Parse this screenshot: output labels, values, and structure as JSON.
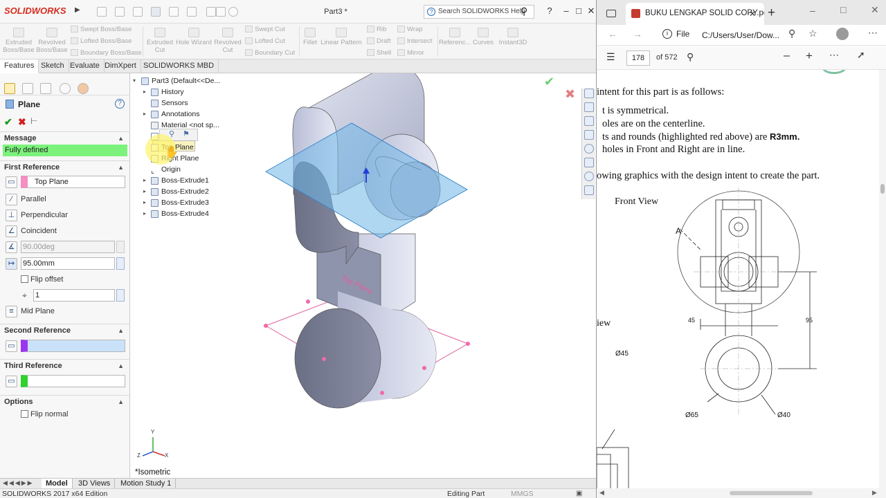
{
  "solidworks": {
    "logo": "SOLIDWORKS",
    "doc_title": "Part3 *",
    "search_placeholder": "Search SOLIDWORKS Help",
    "help_label": "?",
    "commands": {
      "extruded_boss": "Extruded Boss/Base",
      "revolved_boss": "Revolved Boss/Base",
      "swept_boss": "Swept Boss/Base",
      "lofted_boss": "Lofted Boss/Base",
      "boundary_boss": "Boundary Boss/Base",
      "extruded_cut": "Extruded Cut",
      "hole_wizard": "Hole Wizard",
      "revolved_cut": "Revolved Cut",
      "swept_cut": "Swept Cut",
      "lofted_cut": "Lofted Cut",
      "boundary_cut": "Boundary Cut",
      "fillet": "Fillet",
      "linear_pattern": "Linear Pattern",
      "rib": "Rib",
      "draft": "Draft",
      "shell": "Shell",
      "wrap": "Wrap",
      "intersect": "Intersect",
      "mirror": "Mirror",
      "reference": "Referenc...",
      "curves": "Curves",
      "instant3d": "Instant3D"
    },
    "tabs": [
      "Features",
      "Sketch",
      "Evaluate",
      "DimXpert",
      "SOLIDWORKS MBD"
    ],
    "property_manager": {
      "title": "Plane",
      "message_head": "Message",
      "message_text": "Fully defined",
      "first_ref_head": "First Reference",
      "first_ref_value": "Top Plane",
      "parallel": "Parallel",
      "perpendicular": "Perpendicular",
      "coincident": "Coincident",
      "angle_value": "90.00deg",
      "distance_value": "95.00mm",
      "flip_offset": "Flip offset",
      "instances_value": "1",
      "mid_plane": "Mid Plane",
      "second_ref_head": "Second Reference",
      "third_ref_head": "Third Reference",
      "options_head": "Options",
      "flip_normal": "Flip normal"
    },
    "tree": {
      "root": "Part3  (Default<<De...",
      "items": [
        "History",
        "Sensors",
        "Annotations",
        "Material <not sp...",
        "Fr",
        "Top Plane",
        "Right Plane",
        "Origin",
        "Boss-Extrude1",
        "Boss-Extrude2",
        "Boss-Extrude3",
        "Boss-Extrude4"
      ]
    },
    "view_label": "*Isometric",
    "plane_label": "Top Plane",
    "axis_labels": {
      "y": "Y",
      "x": "X",
      "z": "Z"
    },
    "bottom_tabs": [
      "Model",
      "3D Views",
      "Motion Study 1"
    ],
    "status_left": "SOLIDWORKS 2017 x64 Edition",
    "status_mode": "Editing Part",
    "status_units": "MMGS"
  },
  "pdf_viewer": {
    "tab_title": "BUKU LENGKAP SOLID COPY.pdf",
    "file_label": "File",
    "address": "C:/Users/User/Dow...",
    "page_current": "178",
    "page_total": "of 572",
    "lines": [
      "intent for this part is as follows:",
      "t is symmetrical.",
      "oles are on the centerline.",
      "ts and rounds (highlighted red above) are ",
      "holes in Front and Right are in line.",
      "owing graphics with the design intent to create the part."
    ],
    "bold_r3": "R3mm.",
    "front_view_label": "Front View",
    "side_view_label": "iew",
    "dims": {
      "d45_side": "Ø45",
      "w45": "45",
      "h95": "95",
      "d65": "Ø65",
      "d40": "Ø40",
      "section": "A"
    }
  },
  "colors": {
    "sw_red": "#d52b1e",
    "message_green": "#7cf27c",
    "plane_blue": "#6fb6e8",
    "plane_pink": "#e0609e"
  }
}
